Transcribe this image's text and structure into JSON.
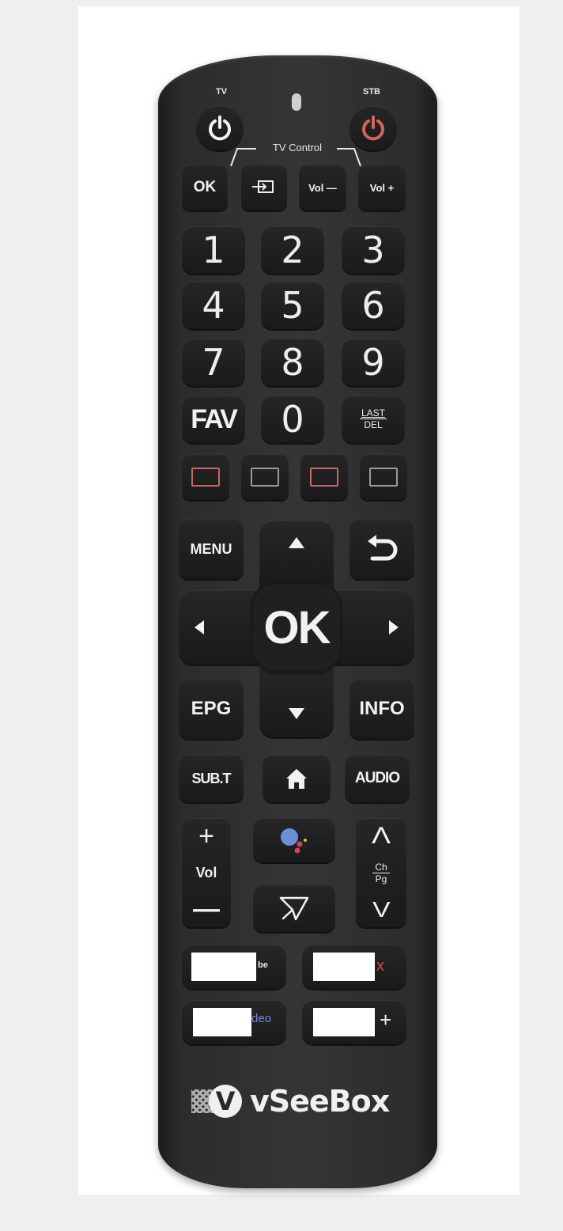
{
  "brand": {
    "name": "vSeeBox"
  },
  "top": {
    "tv_label": "TV",
    "stb_label": "STB",
    "tv_control_label": "TV Control"
  },
  "tv_control": {
    "ok": "OK",
    "vol_minus": "Vol —",
    "vol_plus": "Vol +"
  },
  "numpad": [
    "1",
    "2",
    "3",
    "4",
    "5",
    "6",
    "7",
    "8",
    "9"
  ],
  "row_zero": {
    "fav": "FAV",
    "zero": "0",
    "last": "LAST",
    "del": "DEL"
  },
  "color_buttons": [
    "#c46a5e",
    "#9a9a9a",
    "#c46a5e",
    "#9a9a9a"
  ],
  "nav": {
    "menu": "MENU",
    "ok": "OK",
    "epg": "EPG",
    "info": "INFO"
  },
  "row_sub": {
    "subt": "SUB.T",
    "audio": "AUDIO"
  },
  "vol_rocker": {
    "plus": "+",
    "label": "Vol",
    "minus": "—"
  },
  "ch_rocker": {
    "up": "Λ",
    "ch": "Ch",
    "pg": "Pg",
    "down": "V"
  },
  "app_buttons": [
    {
      "visible_text": "be"
    },
    {
      "visible_text": "x",
      "color": "#d04848"
    },
    {
      "visible_text": "deo",
      "color": "#6d8fd6"
    },
    {
      "visible_text": "+"
    }
  ],
  "colors": {
    "stb_power": "#d4655a",
    "assistant_blue": "#6b8fd6",
    "assistant_red": "#d04848"
  }
}
